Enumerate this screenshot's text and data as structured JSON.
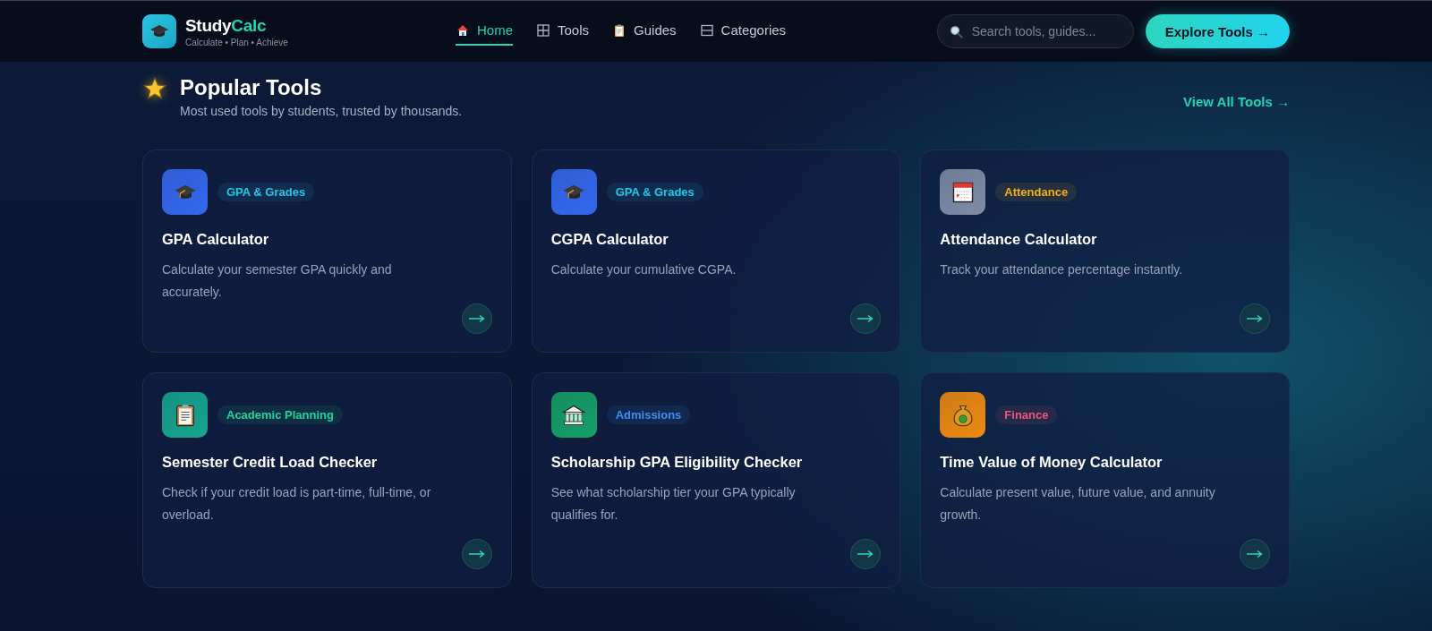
{
  "brand": {
    "name_start": "Study",
    "name_end": "Calc",
    "tagline": "Calculate • Plan • Achieve"
  },
  "nav": [
    {
      "label": "Home",
      "kind": "house",
      "selected": true
    },
    {
      "label": "Tools",
      "kind": "grid",
      "selected": false
    },
    {
      "label": "Guides",
      "kind": "clipboard",
      "selected": false
    },
    {
      "label": "Categories",
      "kind": "rows",
      "selected": false
    }
  ],
  "search": {
    "placeholder": "Search tools, guides..."
  },
  "cta_button": "Explore Tools →",
  "section": {
    "title": "Popular Tools",
    "subtitle": "Most used tools by students, trusted by thousands.",
    "link": "View All Tools →"
  },
  "tools": [
    {
      "icon": {
        "kind": "cap",
        "color": "#3468ee"
      },
      "tag": {
        "label": "GPA & Grades",
        "color": "#22c7e8"
      },
      "title": "GPA Calculator",
      "description": "Calculate your semester GPA quickly and accurately."
    },
    {
      "icon": {
        "kind": "cap",
        "color": "#3468ee"
      },
      "tag": {
        "label": "GPA & Grades",
        "color": "#22c7e8"
      },
      "title": "CGPA Calculator",
      "description": "Calculate your cumulative CGPA."
    },
    {
      "icon": {
        "kind": "calendar",
        "color": "#7f8ca6"
      },
      "tag": {
        "label": "Attendance",
        "color": "#f2b01e"
      },
      "title": "Attendance Calculator",
      "description": "Track your attendance percentage instantly."
    },
    {
      "icon": {
        "kind": "clipboard",
        "color": "#16a58f"
      },
      "tag": {
        "label": "Academic Planning",
        "color": "#1fd49a"
      },
      "title": "Semester Credit Load Checker",
      "description": "Check if your credit load is part-time, full-time, or overload."
    },
    {
      "icon": {
        "kind": "bank",
        "color": "#15a067"
      },
      "tag": {
        "label": "Admissions",
        "color": "#3d8ff0"
      },
      "title": "Scholarship GPA Eligibility Checker",
      "description": "See what scholarship tier your GPA typically qualifies for."
    },
    {
      "icon": {
        "kind": "money",
        "color": "#ee8a10"
      },
      "tag": {
        "label": "Finance",
        "color": "#f0557a"
      },
      "title": "Time Value of Money Calculator",
      "description": "Calculate present value, future value, and annuity growth."
    }
  ]
}
